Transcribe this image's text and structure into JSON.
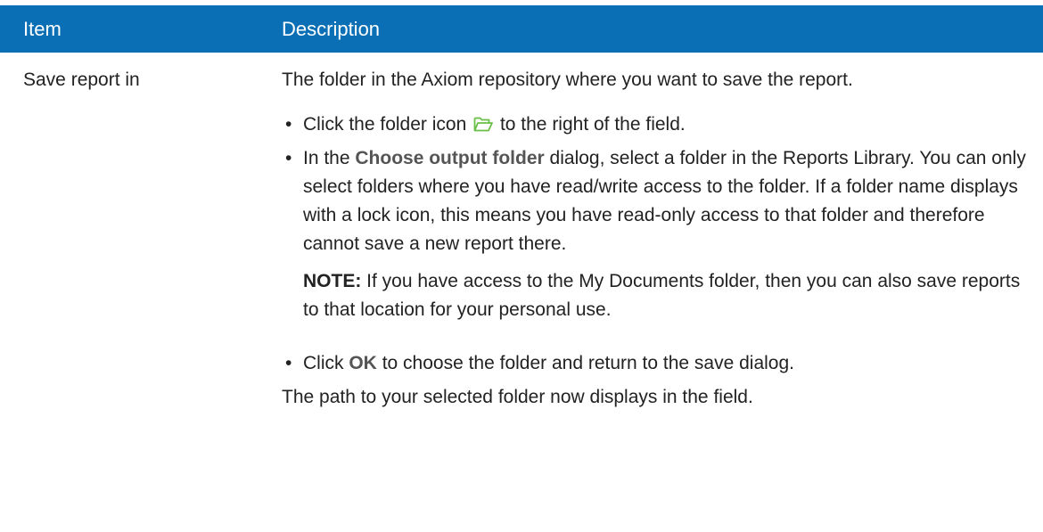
{
  "header": {
    "item": "Item",
    "description": "Description"
  },
  "row": {
    "item": "Save report in",
    "intro": "The folder in the Axiom repository where you want to save the report.",
    "bullet1": {
      "before": "Click the folder icon",
      "after": "to the right of the field.",
      "icon": "folder-open-icon",
      "icon_color": "#6abf47"
    },
    "bullet2": {
      "before": "In the",
      "ui_term": "Choose output folder",
      "after": "dialog, select a folder in the Reports Library. You can only select folders where you have read/write access to the folder. If a folder name displays with a lock icon, this means you have read-only access to that folder and therefore cannot save a new report there."
    },
    "note": {
      "label": "NOTE:",
      "text": "If you have access to the My Documents folder, then you can also save reports to that location for your personal use."
    },
    "bullet3": {
      "before": "Click",
      "ui_term": "OK",
      "after": "to choose the folder and return to the save dialog."
    },
    "final": "The path to your selected folder now displays in the field."
  },
  "colors": {
    "header_bg": "#0a6fb5",
    "header_text": "#ffffff",
    "ui_term": "#555555"
  }
}
